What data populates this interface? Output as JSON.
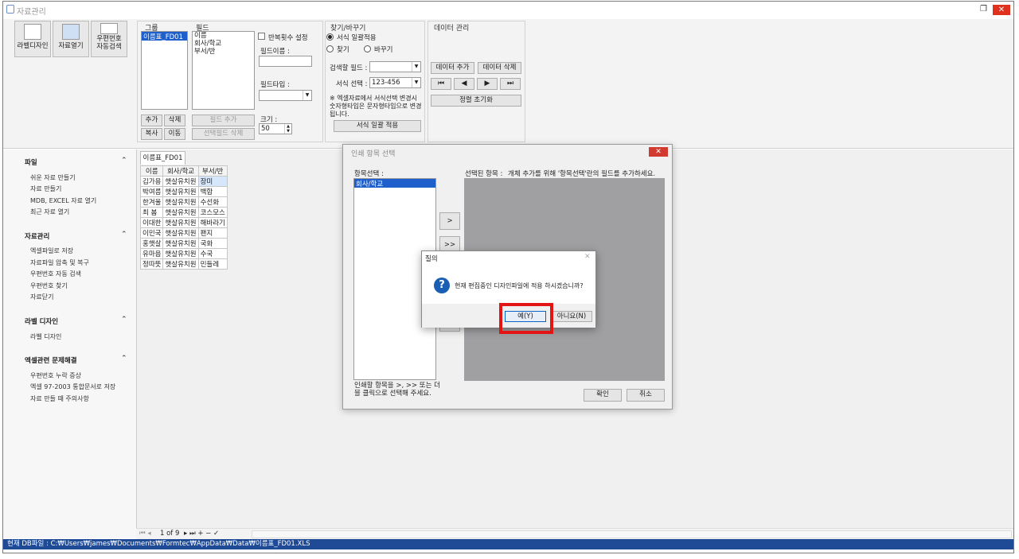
{
  "window": {
    "title": "자료관리"
  },
  "ribbon": {
    "buttons": [
      {
        "label": "라벨디자인"
      },
      {
        "label": "자료열기"
      },
      {
        "label": "우편번호\n자동검색"
      }
    ],
    "group_box": {
      "title": "그룹",
      "items": [
        "이름표_FD01"
      ],
      "add": "추가",
      "delete": "삭제",
      "copy": "복사",
      "move": "이동"
    },
    "field_box": {
      "title": "필드",
      "items": [
        "이름",
        "회사/학교",
        "부서/반"
      ],
      "add_field": "필드 추가",
      "delete_selected": "선택필드 삭제",
      "repeat_label": "반복횟수 설정",
      "field_name_label": "필드이름 :",
      "field_name_value": "",
      "field_type_label": "필드타입 :",
      "field_type_value": "",
      "size_label": "크기 :",
      "size_value": "50"
    },
    "find_replace": {
      "title": "찾기/바꾸기",
      "radio_apply": "서식 일괄적용",
      "radio_find": "찾기",
      "radio_replace": "바꾸기",
      "search_field_label": "검색할 필드 :",
      "search_field_value": "",
      "format_label": "서식 선택 :",
      "format_value": "123-456",
      "note": "※ 엑셀자료에서 서식선택 변경시 숫자형타입은 문자형타입으로 변경됩니다.",
      "apply_button": "서식 일괄 적용"
    },
    "data_mgmt": {
      "title": "데이터 관리",
      "add": "데이터 추가",
      "delete": "데이터 삭제",
      "reset_sort": "정렬 초기화"
    }
  },
  "sidebar": {
    "sections": [
      {
        "title": "파일",
        "items": [
          "쉬운 자료 만들기",
          "자료 만들기",
          "MDB, EXCEL 자료 열기",
          "최근 자료 열기"
        ]
      },
      {
        "title": "자료관리",
        "items": [
          "엑셀파일로 저장",
          "자료파일 압축 및 복구",
          "우편번호 자동 검색",
          "우편번호 찾기",
          "자료닫기"
        ]
      },
      {
        "title": "라벨 디자인",
        "items": [
          "라벨 디자인"
        ]
      },
      {
        "title": "엑셀관련 문제해결",
        "items": [
          "우편번호 누락 증상",
          "엑셀 97-2003 통합문서로 저장",
          "자료 만들 때 주의사항"
        ]
      }
    ]
  },
  "main": {
    "tab": "이름표_FD01",
    "columns": [
      "이름",
      "회사/학교",
      "부서/반"
    ],
    "rows": [
      [
        "김가용",
        "햇살유치원",
        "장미"
      ],
      [
        "박여름",
        "햇살유치원",
        "백합"
      ],
      [
        "한겨울",
        "햇살유치원",
        "수선화"
      ],
      [
        "최 봄",
        "햇살유치원",
        "코스모스"
      ],
      [
        "이대한",
        "햇살유치원",
        "해바라기"
      ],
      [
        "이민국",
        "햇살유치원",
        "팬지"
      ],
      [
        "홍햇살",
        "햇살유치원",
        "국화"
      ],
      [
        "유마음",
        "햇살유치원",
        "수국"
      ],
      [
        "정따뜻",
        "햇살유치원",
        "민들레"
      ]
    ],
    "pager": "1 of 9"
  },
  "status": {
    "text": "현재 DB파일 : C:₩Users₩james₩Documents₩Formtec₩AppData₩Data₩이름표_FD01.XLS"
  },
  "print_dialog": {
    "title": "인쇄 항목 선택",
    "items_label": "항목선택 :",
    "items": [
      "회사/학교"
    ],
    "selected_label": "선택된 항목 :",
    "selected_hint": "개체 추가를 위해 '항목선택'란의 필드를 추가하세요.",
    "move_one": ">",
    "move_all": ">>",
    "help": "인쇄할 항목을 >, >> 또는 더블 클릭으로 선택해 주세요.",
    "ok": "확인",
    "cancel": "취소"
  },
  "confirm": {
    "title": "질의",
    "message": "현재 편집중인 디자인파일에 적용 하시겠습니까?",
    "yes": "예(Y)",
    "no": "아니요(N)"
  },
  "colors": {
    "status_bar": "#1e4a96",
    "selection": "#1e5fcc",
    "highlight": "#e31414",
    "close": "#e0301e"
  }
}
